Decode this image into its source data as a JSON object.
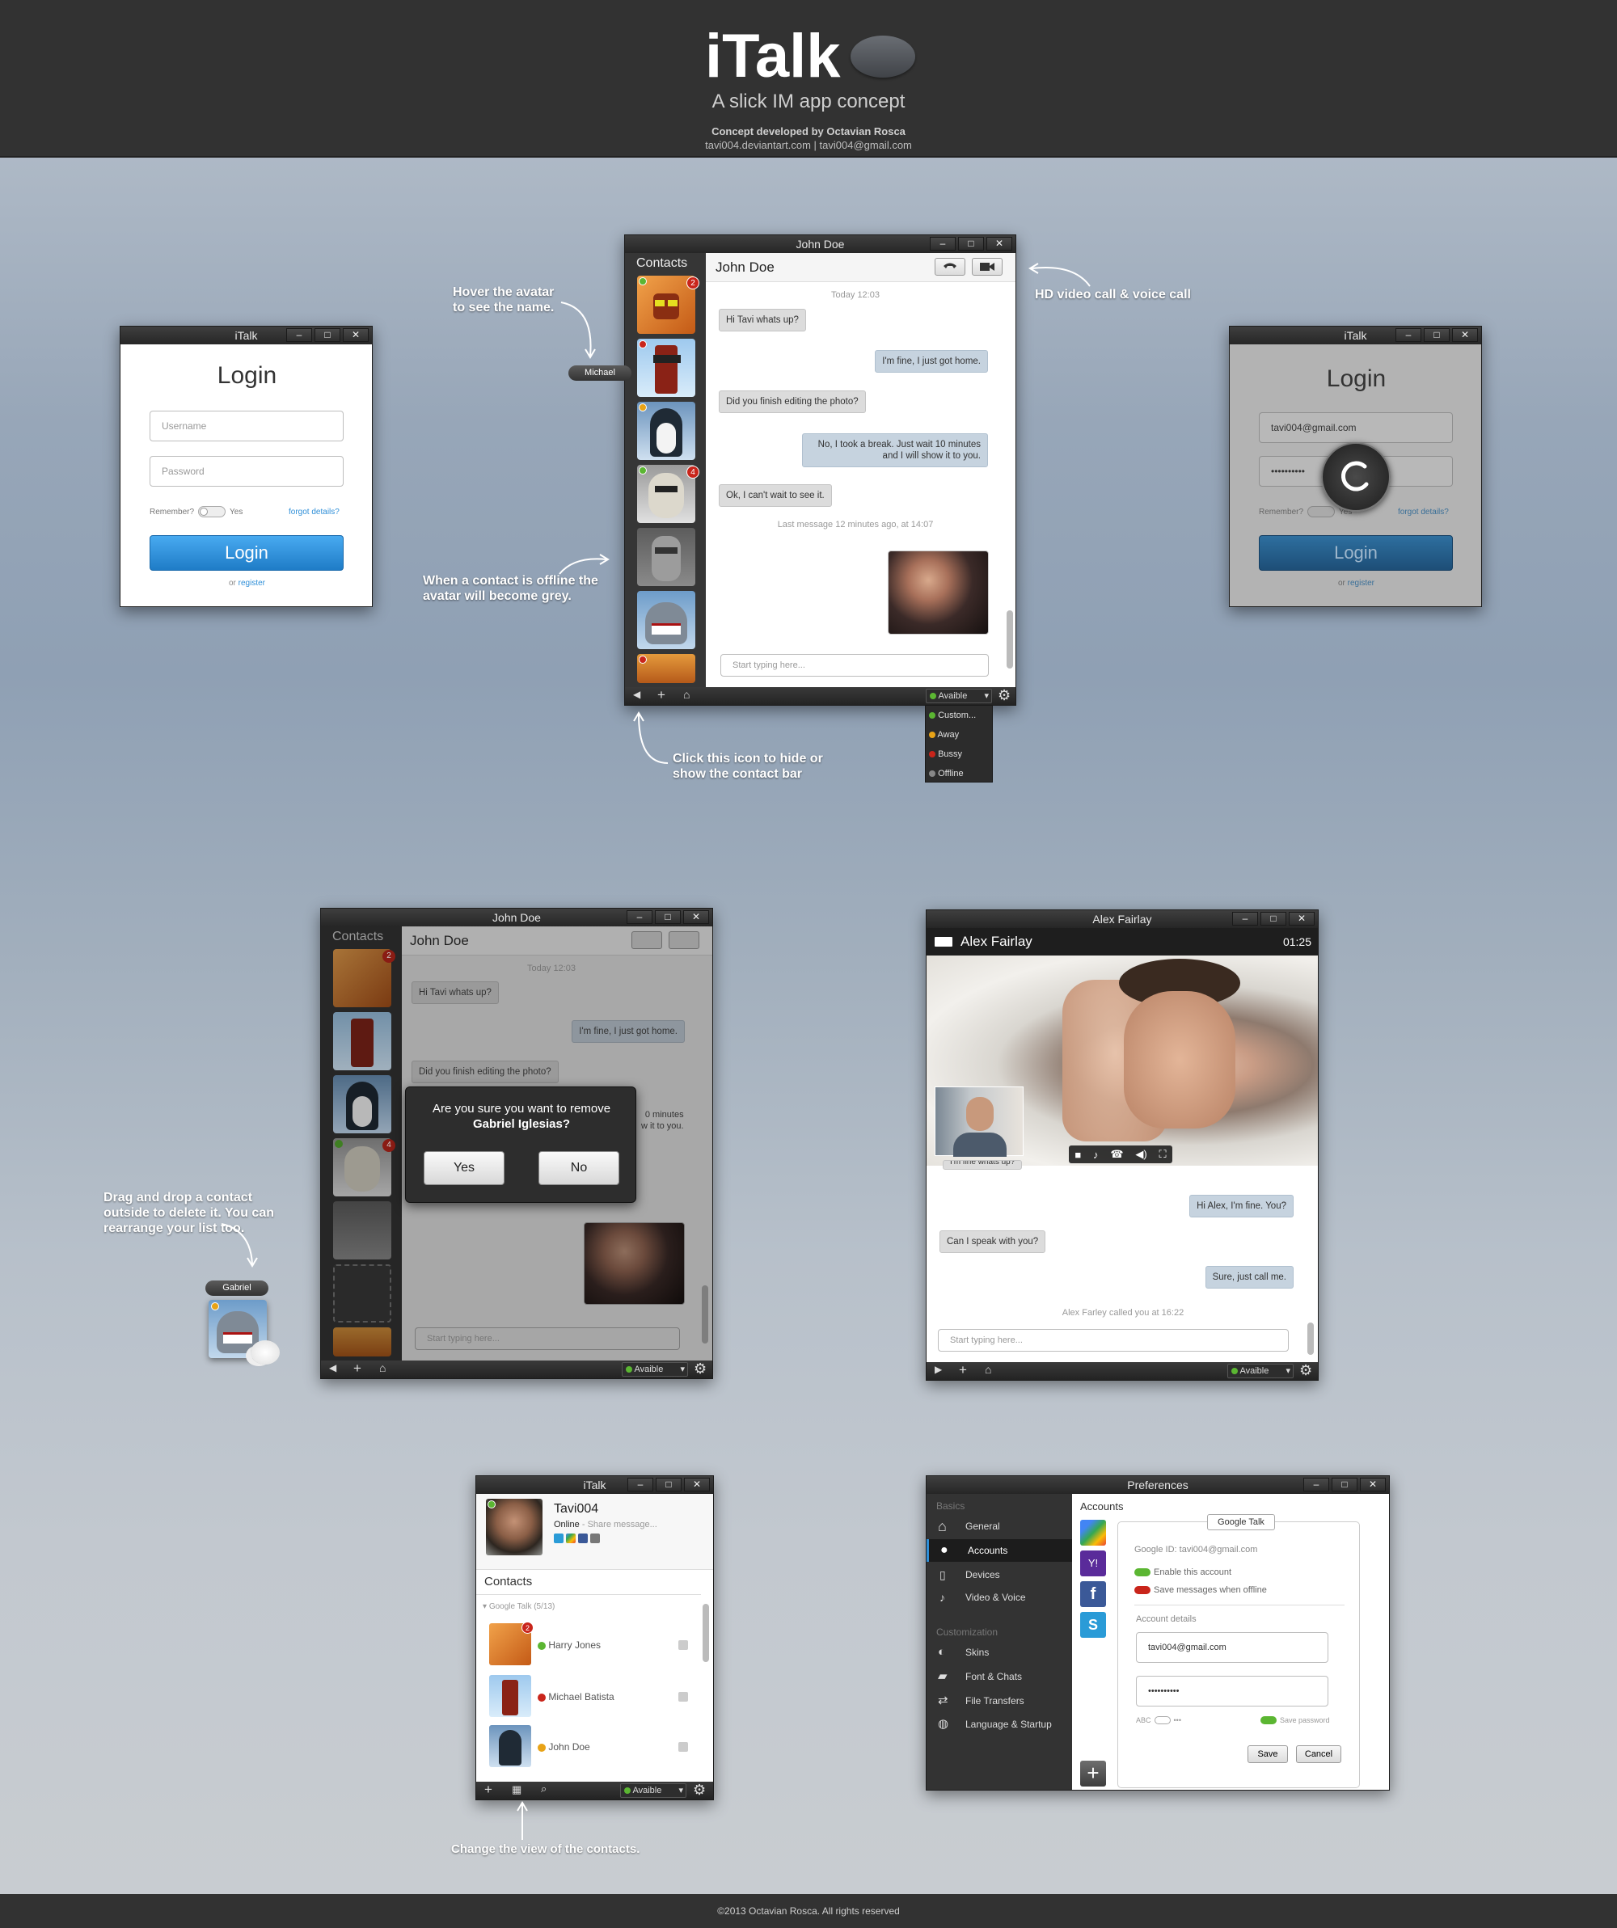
{
  "header": {
    "title": "iTalk",
    "subtitle": "A slick IM app concept",
    "credit": "Concept developed by Octavian Rosca",
    "links": "tavi004.deviantart.com | tavi004@gmail.com"
  },
  "footer": {
    "copyright": "©2013 Octavian Rosca. All rights reserved"
  },
  "annotations": {
    "hover": "Hover the avatar to see the name.",
    "hover_name": "Michael",
    "offline": "When a contact is offline the avatar will become grey.",
    "video": "HD video call & voice call",
    "hide": "Click this icon to hide or show the contact bar",
    "drag": "Drag and drop a contact outside to delete it. You can rearrange your list too.",
    "drag_name": "Gabriel",
    "view": "Change the view of the contacts."
  },
  "login": {
    "window_title": "iTalk",
    "heading": "Login",
    "username_placeholder": "Username",
    "password_placeholder": "Password",
    "remember": "Remember?",
    "yes": "Yes",
    "forgot": "forgot details?",
    "button": "Login",
    "or": "or",
    "register": "register"
  },
  "login2": {
    "window_title": "iTalk",
    "heading": "Login",
    "username": "tavi004@gmail.com",
    "password": "••••••••••",
    "remember": "Remember?",
    "yes": "Yes",
    "forgot": "forgot details?",
    "button": "Login",
    "or": "or",
    "register": "register"
  },
  "window_controls": {
    "minimize": "–",
    "maximize": "□",
    "close": "✕"
  },
  "chat": {
    "window_title": "John Doe",
    "contacts_label": "Contacts",
    "name": "John Doe",
    "date": "Today 12:03",
    "messages": [
      {
        "side": "left",
        "text": "Hi Tavi whats up?"
      },
      {
        "side": "right",
        "text": "I'm fine, I just got home."
      },
      {
        "side": "left",
        "text": "Did you finish editing the photo?"
      },
      {
        "side": "right",
        "text": "No, I took a break. Just wait 10 minutes and I will show it to you."
      },
      {
        "side": "left",
        "text": "Ok, I can't wait to see it."
      }
    ],
    "last": "Last message 12 minutes ago, at 14:07",
    "input_placeholder": "Start typing here...",
    "status": "Avaible",
    "badge1": "2",
    "badge2": "4",
    "status_menu": [
      "Custom...",
      "Away",
      "Bussy",
      "Offline"
    ]
  },
  "dialog": {
    "question": "Are you sure you want to remove",
    "name": "Gabriel Iglesias?",
    "yes": "Yes",
    "no": "No",
    "partial": "0 minutes",
    "partial2": "w it to you."
  },
  "video": {
    "window_title": "Alex Fairlay",
    "name": "Alex Fairlay",
    "time": "01:25",
    "messages": [
      {
        "side": "right",
        "text": "Hi Alex, I'm fine. You?"
      },
      {
        "side": "left",
        "text": "Can I speak with you?"
      },
      {
        "side": "right",
        "text": "Sure, just call me."
      }
    ],
    "partial": "I'm fine whats up?",
    "called": "Alex Farley called you at 16:22",
    "input_placeholder": "Start typing here...",
    "status": "Avaible"
  },
  "contacts": {
    "window_title": "iTalk",
    "username": "Tavi004",
    "online": "Online",
    "share": "Share message...",
    "section": "Contacts",
    "group": "Google Talk (5/13)",
    "items": [
      {
        "name": "Harry Jones",
        "status": "online"
      },
      {
        "name": "Michael Batista",
        "status": "busy"
      },
      {
        "name": "John Doe",
        "status": "away"
      }
    ],
    "badge": "2",
    "status": "Avaible"
  },
  "prefs": {
    "window_title": "Preferences",
    "basics": "Basics",
    "basics_items": [
      "General",
      "Accounts",
      "Devices",
      "Video & Voice"
    ],
    "customization": "Customization",
    "custom_items": [
      "Skins",
      "Font & Chats",
      "File Transfers",
      "Language & Startup"
    ],
    "accounts_title": "Accounts",
    "tab": "Google Talk",
    "google_id": "Google ID: tavi004@gmail.com",
    "enable": "Enable this account",
    "save_offline": "Save messages when offline",
    "details": "Account details",
    "email": "tavi004@gmail.com",
    "password": "••••••••••",
    "abc": "ABC",
    "dots": "•••",
    "save_password": "Save password",
    "save": "Save",
    "cancel": "Cancel"
  },
  "colors": {
    "online": "#5bb632",
    "away": "#e8a317",
    "busy": "#c9251b",
    "offline": "#888888",
    "accent": "#2f8fd8",
    "header": "#323232"
  }
}
